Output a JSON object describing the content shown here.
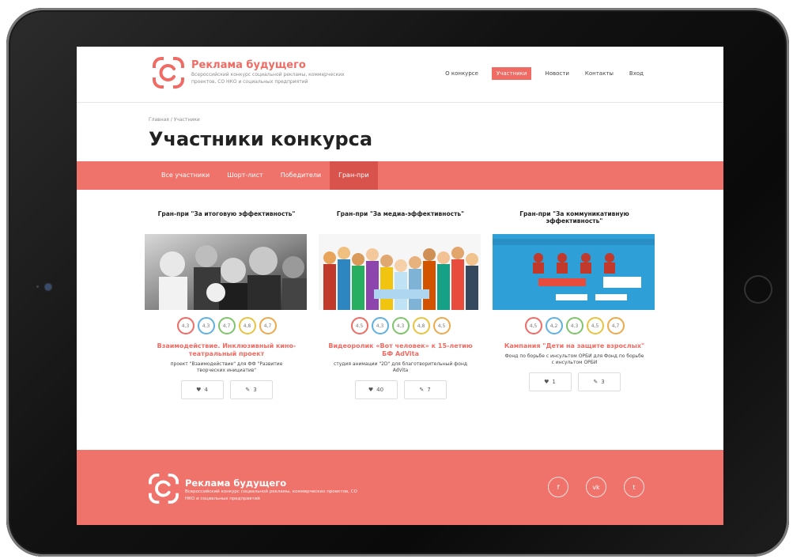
{
  "header": {
    "logo_title": "Реклама будущего",
    "logo_subtitle": "Всероссийский конкурс социальной рекламы, коммерческих проектов, СО НКО и социальных предприятий",
    "nav": [
      "О конкурсе",
      "Участники",
      "Новости",
      "Контакты",
      "Вход"
    ],
    "active_nav": "Участники"
  },
  "breadcrumb": "Главная / Участники",
  "page_title": "Участники конкурса",
  "tabs": [
    "Все участники",
    "Шорт-лист",
    "Победители",
    "Гран-при"
  ],
  "active_tab": "Гран-при",
  "cards": [
    {
      "heading": "Гран-при \"За итоговую эффективность\"",
      "scores": [
        "4,3",
        "4,3",
        "4,7",
        "4,8",
        "4,7"
      ],
      "title": "Взаимодействие. Инклюзивный кино-театральный проект",
      "description": "проект \"Взаимодействие\" для ФФ \"Развитие творческих инициатив\"",
      "likes": "4",
      "comments": "3"
    },
    {
      "heading": "Гран-при \"За медиа-эффективность\"",
      "scores": [
        "4,5",
        "4,3",
        "4,3",
        "4,8",
        "4,5"
      ],
      "title": "Видеоролик «Вот человек» к 15-летию БФ AdVita",
      "description": "студия анимации \"2D\" для благотворительный фонд AdVita",
      "likes": "40",
      "comments": "7"
    },
    {
      "heading": "Гран-при \"За коммуникативную эффективность\"",
      "scores": [
        "4,5",
        "4,2",
        "4,3",
        "4,5",
        "4,7"
      ],
      "title": "Кампания \"Дети на защите взрослых\"",
      "description": "Фонд по борьбе с инсультом ОРБИ для Фонд по борьбе с инсультом ОРБИ",
      "likes": "1",
      "comments": "3"
    }
  ],
  "footer": {
    "logo_title": "Реклама будущего",
    "logo_subtitle": "Всероссийский конкурс социальной рекламы, коммерческих проектов, СО НКО и социальных предприятий"
  },
  "colors": {
    "accent": "#ef6b63",
    "tab_active": "#d9534d"
  }
}
